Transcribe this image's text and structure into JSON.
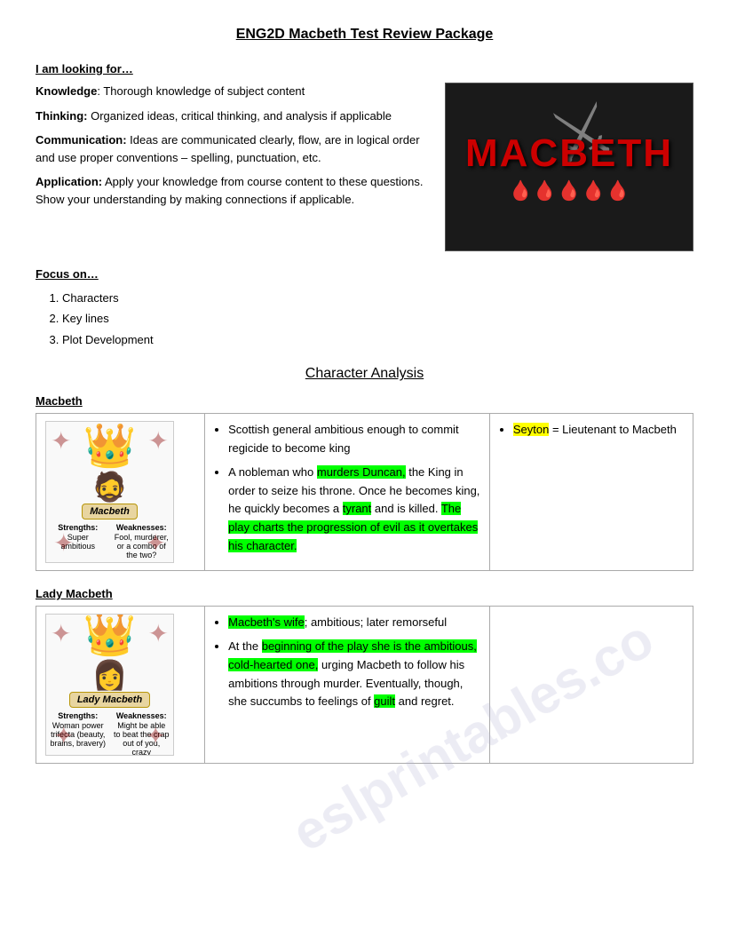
{
  "page": {
    "title": "ENG2D Macbeth Test Review Package"
  },
  "intro": {
    "looking_header": "I am looking for…",
    "items": [
      {
        "label": "Knowledge",
        "text": ": Thorough knowledge of subject content"
      },
      {
        "label": "Thinking:",
        "text": " Organized ideas, critical thinking, and analysis if applicable"
      },
      {
        "label": "Communication:",
        "text": " Ideas are communicated clearly, flow, are in logical order and use proper conventions – spelling, punctuation, etc."
      },
      {
        "label": "Application:",
        "text": " Apply your knowledge from course content to these questions.  Show your understanding by making connections if applicable."
      }
    ]
  },
  "focus": {
    "header": "Focus on…",
    "items": [
      "Characters",
      "Key lines",
      "Plot Development"
    ]
  },
  "character_analysis": {
    "title": "Character Analysis",
    "characters": [
      {
        "name": "Macbeth",
        "image_label": "Macbeth",
        "strengths_label": "Strengths:",
        "strengths_text": "Super ambitious",
        "weaknesses_label": "Weaknesses:",
        "weaknesses_text": "Fool, murderer, or a combo of the two?",
        "desc_bullets": [
          {
            "parts": [
              {
                "text": "Scottish general ambitious enough to commit regicide to become king",
                "highlight": "none"
              }
            ]
          },
          {
            "parts": [
              {
                "text": "A nobleman who ",
                "highlight": "none"
              },
              {
                "text": "murders Duncan,",
                "highlight": "green"
              },
              {
                "text": " the King in order to seize his throne. Once he becomes king, he quickly becomes a ",
                "highlight": "none"
              },
              {
                "text": "tyrant",
                "highlight": "green"
              },
              {
                "text": " and is killed. ",
                "highlight": "none"
              },
              {
                "text": "The play charts the progression of evil as it overtakes his character.",
                "highlight": "green"
              }
            ]
          }
        ],
        "extra_bullets": [
          {
            "parts": [
              {
                "text": "Seyton",
                "highlight": "yellow"
              },
              {
                "text": " = Lieutenant to Macbeth",
                "highlight": "none"
              }
            ]
          }
        ]
      },
      {
        "name": "Lady Macbeth",
        "image_label": "Lady Macbeth",
        "strengths_label": "Strengths:",
        "strengths_text": "Woman power trifecta (beauty, brains, bravery)",
        "weaknesses_label": "Weaknesses:",
        "weaknesses_text": "Might be able to beat the crap out of you, crazy",
        "desc_bullets": [
          {
            "parts": [
              {
                "text": "Macbeth's wife",
                "highlight": "green"
              },
              {
                "text": "; ambitious; later remorseful",
                "highlight": "none"
              }
            ]
          },
          {
            "parts": [
              {
                "text": "At the ",
                "highlight": "none"
              },
              {
                "text": "beginning of the play she is the ambitious, cold-hearted one,",
                "highlight": "green"
              },
              {
                "text": " urging Macbeth to follow his ambitions through murder. Eventually, though, she succumbs to feelings of ",
                "highlight": "none"
              },
              {
                "text": "guilt",
                "highlight": "green"
              },
              {
                "text": " and regret.",
                "highlight": "none"
              }
            ]
          }
        ],
        "extra_bullets": []
      }
    ]
  }
}
